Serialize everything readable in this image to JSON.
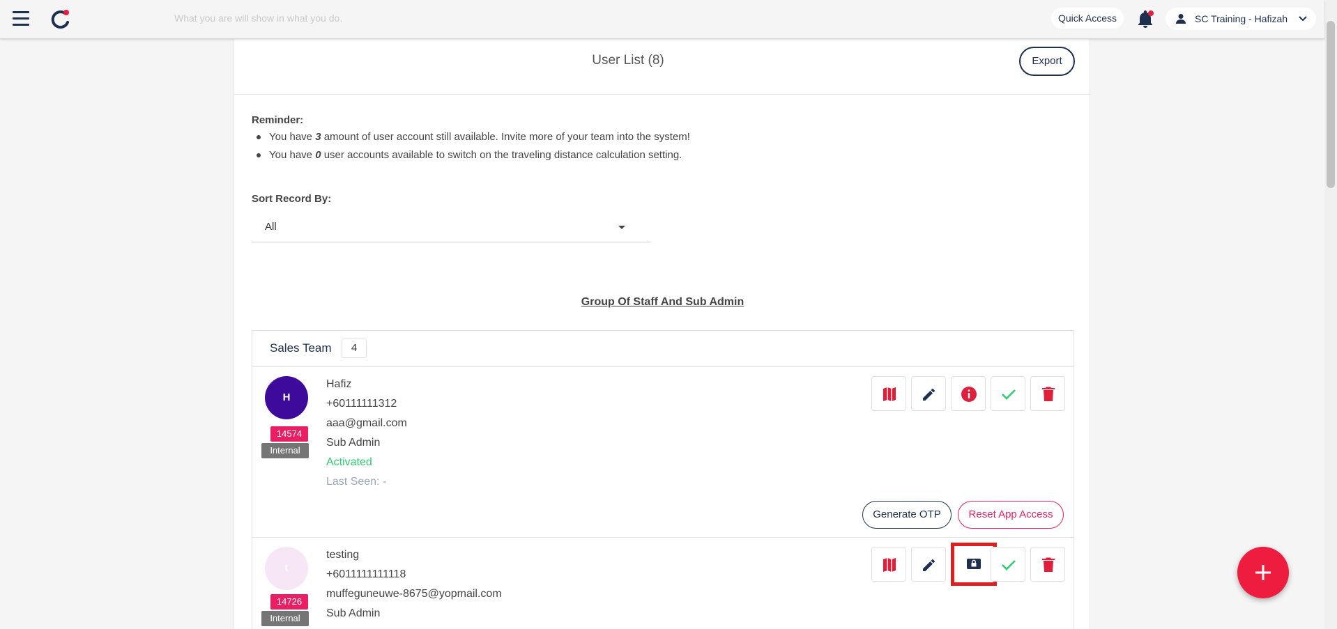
{
  "topbar": {
    "search_placeholder": "What you are will show in what you do.",
    "quick_access": "Quick Access",
    "user_name": "SC Training - Hafizah"
  },
  "page": {
    "title": "User List (8)",
    "export_label": "Export"
  },
  "reminder": {
    "title": "Reminder:",
    "line1_pre": "You have ",
    "line1_num": "3",
    "line1_post": " amount of user account still available. Invite more of your team into the system!",
    "line2_pre": "You have ",
    "line2_num": "0",
    "line2_post": " user accounts available to switch on the traveling distance calculation setting."
  },
  "sort": {
    "label": "Sort Record By:",
    "value": "All"
  },
  "group_title": "Group Of Staff And Sub Admin",
  "team": {
    "name": "Sales Team",
    "count": "4",
    "users": [
      {
        "initial": "H",
        "avatar_color": "#3d0a9c",
        "id": "14574",
        "type": "Internal",
        "name": "Hafiz",
        "phone": "+60111111312",
        "email": "aaa@gmail.com",
        "role": "Sub Admin",
        "status": "Activated",
        "last_seen": "Last Seen: -",
        "otp_label": "Generate OTP",
        "reset_label": "Reset App Access"
      },
      {
        "initial": "t",
        "avatar_color": "#f6e6f6",
        "id": "14726",
        "type": "Internal",
        "name": "testing",
        "phone": "+6011111111118",
        "email": "muffeguneuwe-8675@yopmail.com",
        "role": "Sub Admin"
      }
    ]
  },
  "colors": {
    "navy": "#1e3050",
    "accent_red": "#e0203a",
    "pink": "#e91e63",
    "green": "#2ecc71"
  }
}
